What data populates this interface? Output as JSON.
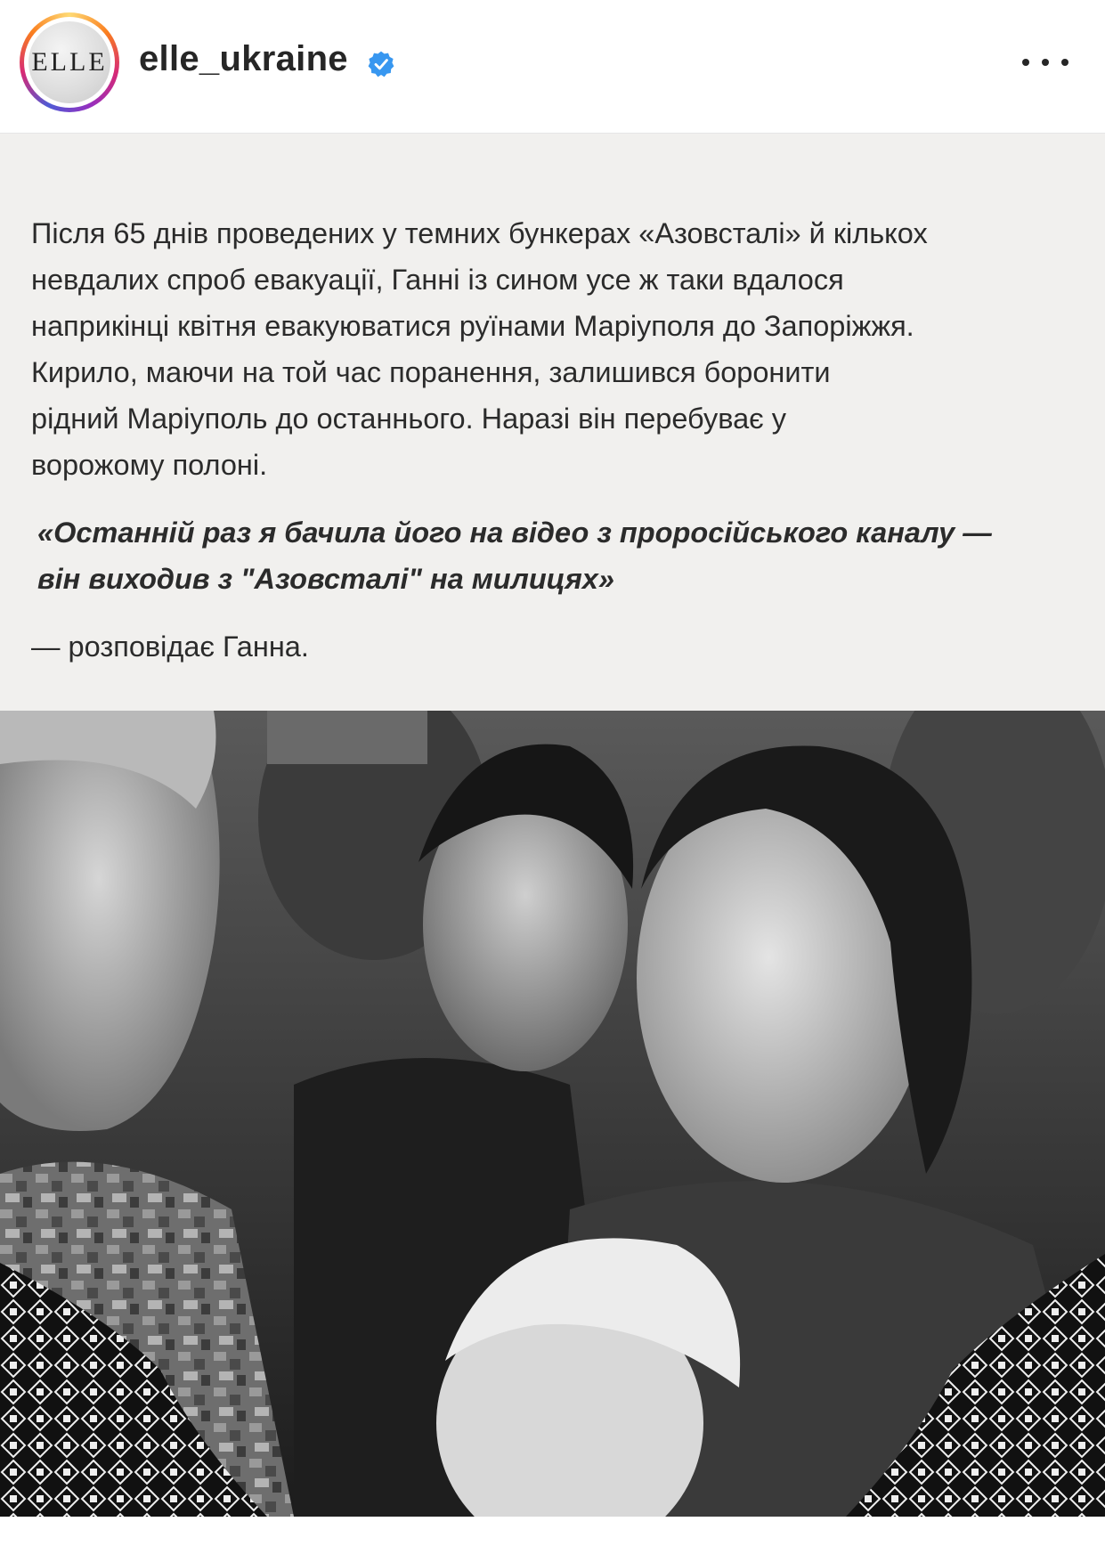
{
  "header": {
    "avatar_logo": "ELLE",
    "username": "elle_ukraine",
    "verified_icon": "verified-badge-icon",
    "more_icon": "more-options-icon"
  },
  "post": {
    "body_lines": [
      "Після 65 днів проведених у темних бункерах «Азовсталі» й кількох",
      "невдалих спроб евакуації, Ганні із сином усе ж таки вдалося",
      "наприкінці квітня евакуюватися руїнами Маріуполя до Запоріжжя.",
      "Кирило, маючи на той час поранення, залишився боронити",
      "рідний Маріуполь до останнього. Наразі він перебуває у",
      "ворожому полоні."
    ],
    "quote_lines": [
      "«Останній раз я бачила його на відео з проросійського каналу —",
      "він виходив з \"Азовсталі\" на милицях»"
    ],
    "attribution": "— розповідає Ганна."
  },
  "colors": {
    "verified_blue": "#3897f0",
    "card_background": "#f1f0ee",
    "text": "#2b2b2b"
  }
}
